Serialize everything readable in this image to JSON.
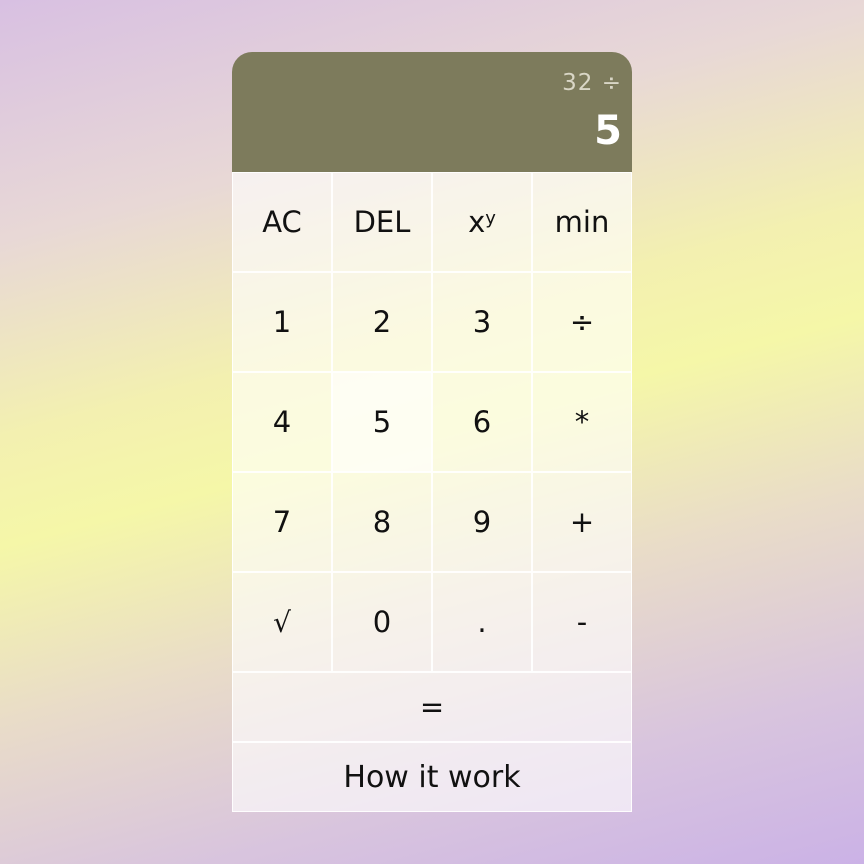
{
  "display": {
    "previous": "32 ÷",
    "current": "5"
  },
  "keys": {
    "ac": "AC",
    "del": "DEL",
    "pow_base": "x",
    "pow_exp": "y",
    "min": "min",
    "k1": "1",
    "k2": "2",
    "k3": "3",
    "divide": "÷",
    "k4": "4",
    "k5": "5",
    "k6": "6",
    "multiply": "*",
    "k7": "7",
    "k8": "8",
    "k9": "9",
    "plus": "+",
    "sqrt": "√",
    "k0": "0",
    "dot": ".",
    "minus": "-",
    "equals": "=",
    "how": "How it work"
  },
  "colors": {
    "display_bg": "#7d7b5c",
    "current_text": "#ffffff",
    "previous_text": "#d9d6c6"
  }
}
